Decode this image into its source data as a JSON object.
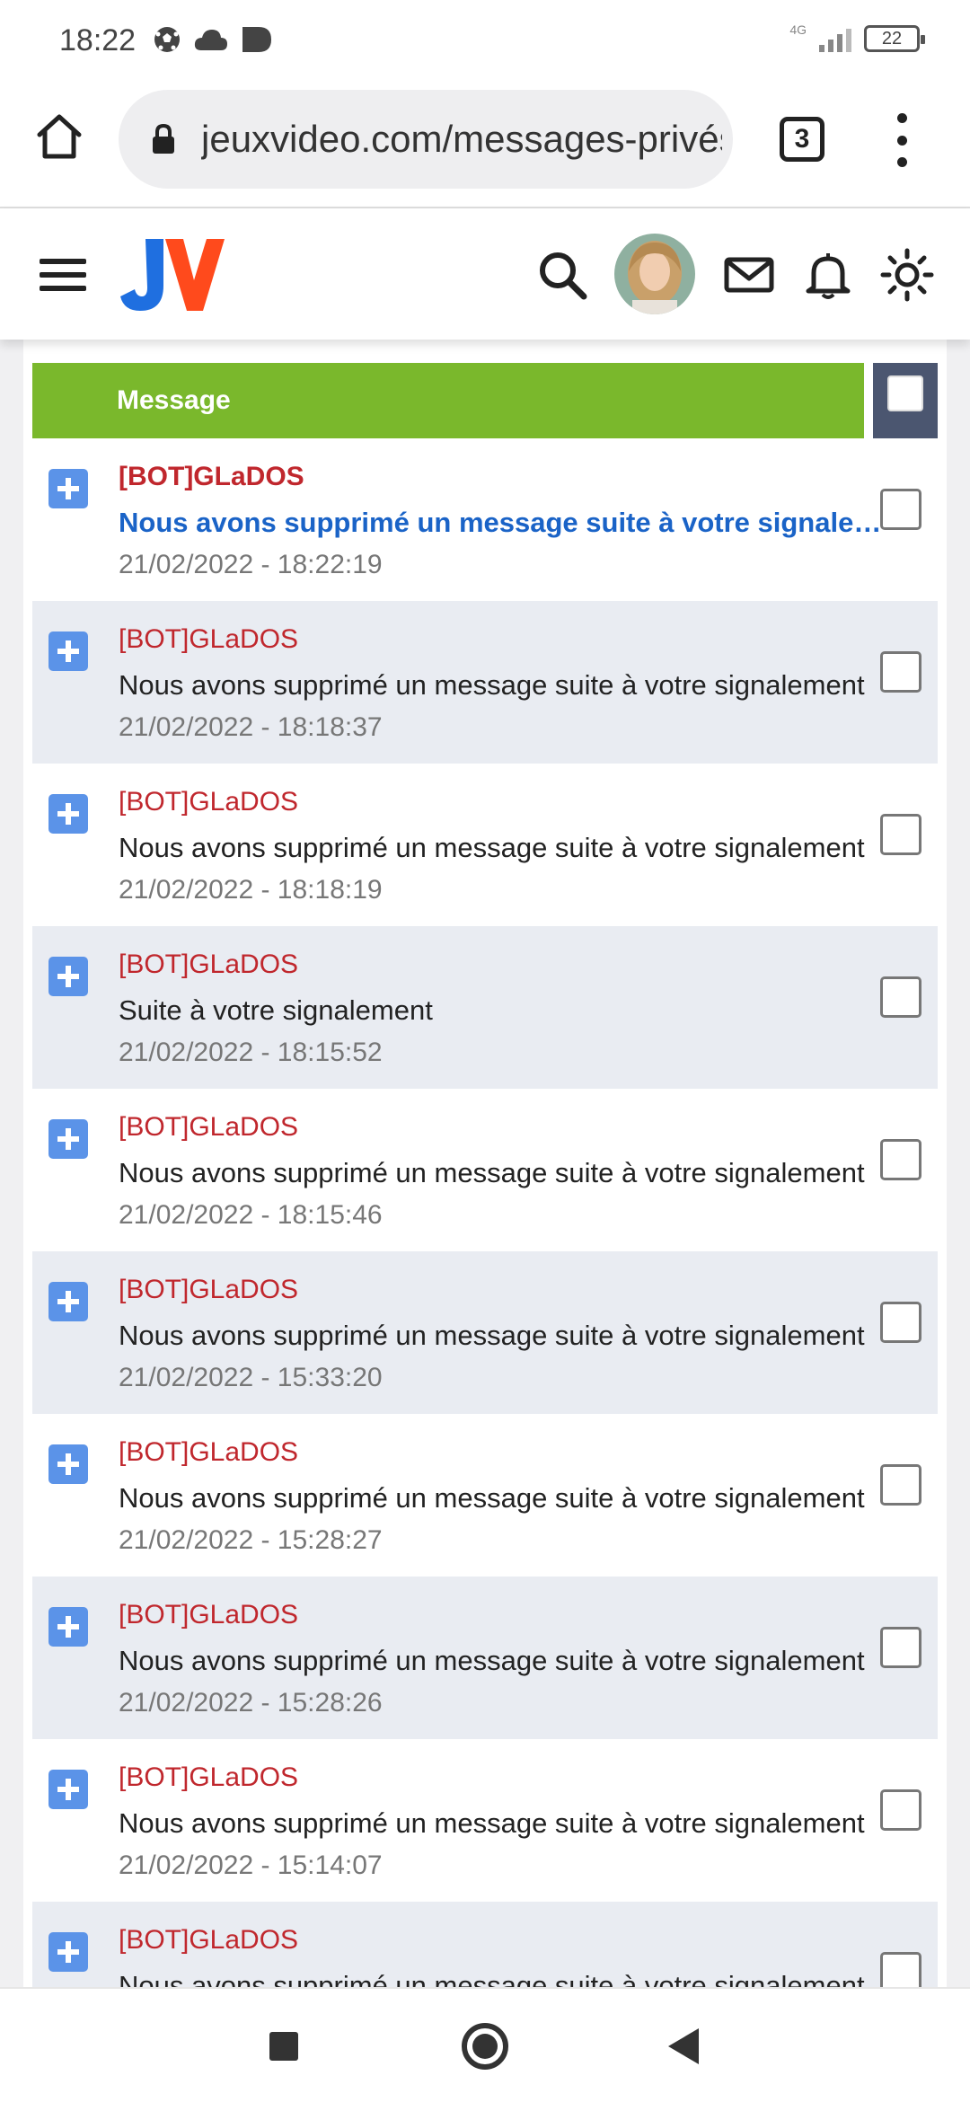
{
  "status_bar": {
    "time": "18:22",
    "network": "4G",
    "battery": "22"
  },
  "browser": {
    "url": "jeuxvideo.com/messages-privés",
    "tabs_count": "3"
  },
  "site": {
    "logo_text": "JV"
  },
  "table": {
    "header_label": "Message",
    "rows": [
      {
        "sender": "[BOT]GLaDOS",
        "subject": "Nous avons supprimé un message suite à votre signalement",
        "date": "21/02/2022 - 18:22:19",
        "unread": true
      },
      {
        "sender": "[BOT]GLaDOS",
        "subject": "Nous avons supprimé un message suite à votre signalement",
        "date": "21/02/2022 - 18:18:37",
        "unread": false
      },
      {
        "sender": "[BOT]GLaDOS",
        "subject": "Nous avons supprimé un message suite à votre signalement",
        "date": "21/02/2022 - 18:18:19",
        "unread": false
      },
      {
        "sender": "[BOT]GLaDOS",
        "subject": "Suite à votre signalement",
        "date": "21/02/2022 - 18:15:52",
        "unread": false
      },
      {
        "sender": "[BOT]GLaDOS",
        "subject": "Nous avons supprimé un message suite à votre signalement",
        "date": "21/02/2022 - 18:15:46",
        "unread": false
      },
      {
        "sender": "[BOT]GLaDOS",
        "subject": "Nous avons supprimé un message suite à votre signalement",
        "date": "21/02/2022 - 15:33:20",
        "unread": false
      },
      {
        "sender": "[BOT]GLaDOS",
        "subject": "Nous avons supprimé un message suite à votre signalement",
        "date": "21/02/2022 - 15:28:27",
        "unread": false
      },
      {
        "sender": "[BOT]GLaDOS",
        "subject": "Nous avons supprimé un message suite à votre signalement",
        "date": "21/02/2022 - 15:28:26",
        "unread": false
      },
      {
        "sender": "[BOT]GLaDOS",
        "subject": "Nous avons supprimé un message suite à votre signalement",
        "date": "21/02/2022 - 15:14:07",
        "unread": false
      },
      {
        "sender": "[BOT]GLaDOS",
        "subject": "Nous avons supprimé un message suite à votre signalement",
        "date": "",
        "unread": false
      }
    ]
  },
  "colors": {
    "header_green": "#7ab82c",
    "header_check_bg": "#4b5670",
    "sender_red": "#c0272d",
    "unread_blue": "#1a63c7",
    "expand_blue": "#5b93e8",
    "alt_row": "#e9ecf2"
  }
}
